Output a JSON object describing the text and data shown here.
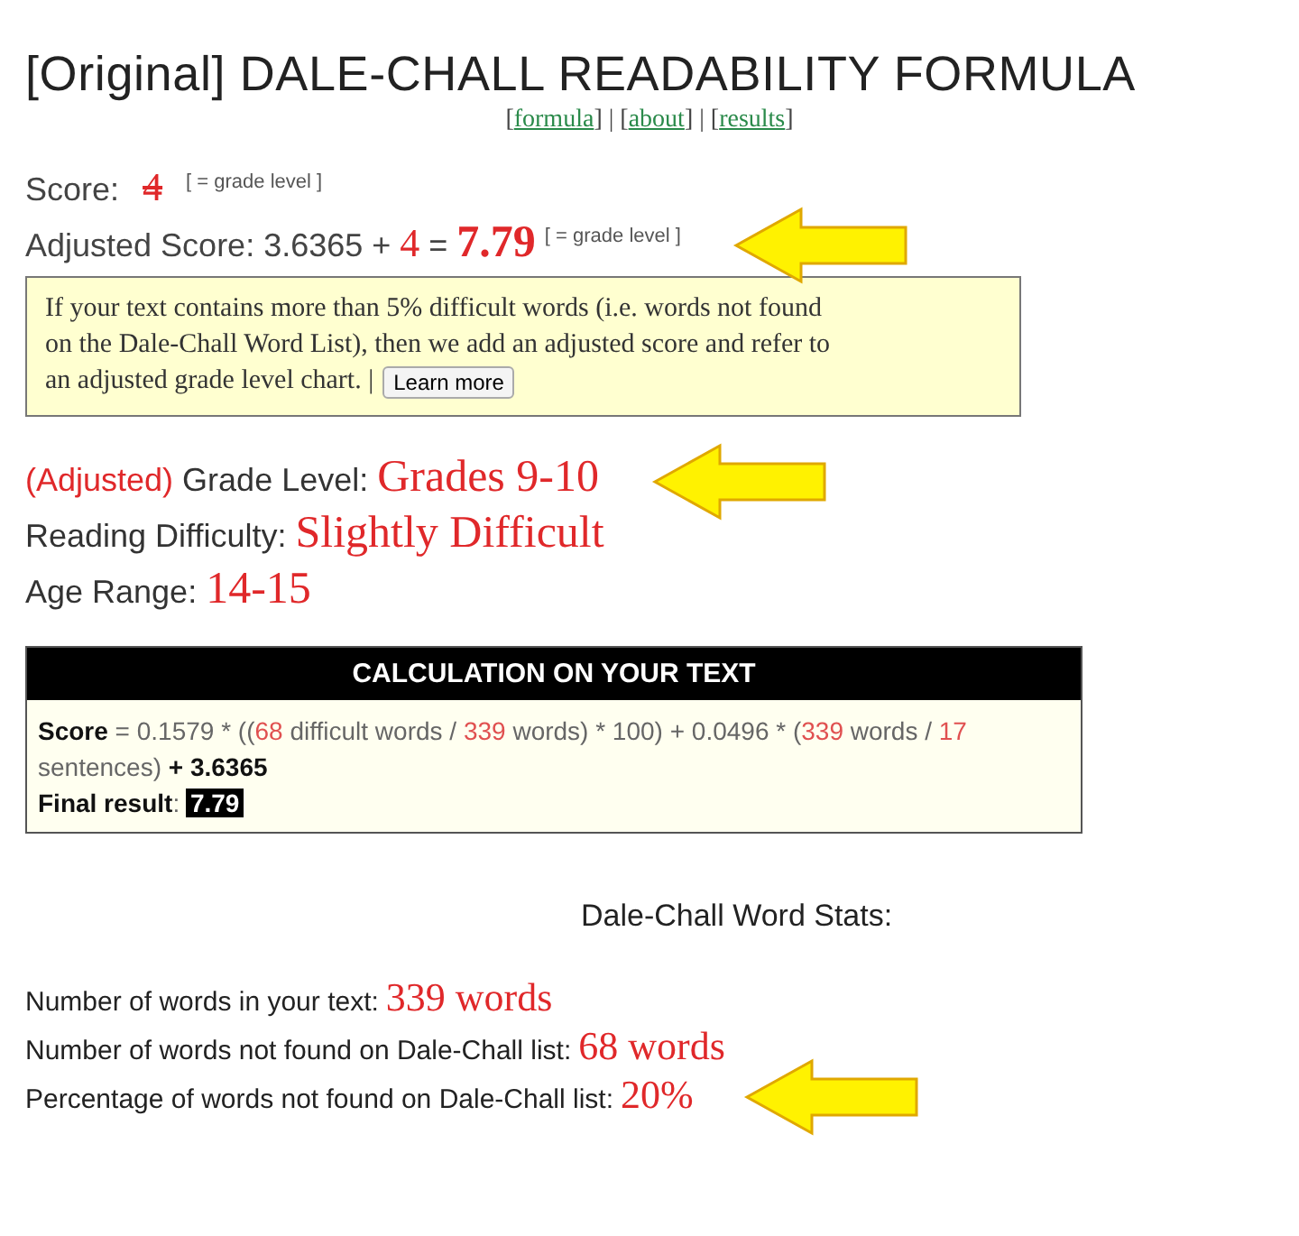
{
  "title": "[Original] DALE-CHALL READABILITY FORMULA",
  "nav": [
    {
      "kind": "punct",
      "text": "["
    },
    {
      "kind": "link",
      "text": "formula"
    },
    {
      "kind": "punct",
      "text": "] | ["
    },
    {
      "kind": "link",
      "text": "about"
    },
    {
      "kind": "punct",
      "text": "] | ["
    },
    {
      "kind": "link",
      "text": "results"
    },
    {
      "kind": "punct",
      "text": "]"
    }
  ],
  "score": {
    "label": "Score:",
    "value": "4",
    "struck": true,
    "note": "[ = grade level ]",
    "arrow": false
  },
  "adjusted_score": {
    "label": "Adjusted Score:",
    "base": "3.6365 +",
    "added": "4",
    "equals": "=",
    "result": "7.79",
    "note": "[ = grade level ]",
    "arrow": true
  },
  "info_box": {
    "lines": [
      "If your text contains more than 5% difficult words (i.e. words not found",
      "on the Dale-Chall Word List), then we add an adjusted score and refer to",
      "an adjusted grade level chart. |"
    ],
    "button": "Learn more"
  },
  "results": [
    {
      "prefix": "(Adjusted)",
      "label": "Grade Level:",
      "value": "Grades 9-10",
      "arrow": true
    },
    {
      "label": "Reading Difficulty:",
      "value": "Slightly Difficult",
      "arrow": false
    },
    {
      "label": "Age Range:",
      "value": "14-15",
      "arrow": false
    }
  ],
  "calculation": {
    "header": "CALCULATION ON YOUR TEXT",
    "formula": [
      {
        "kind": "bold",
        "text": "Score"
      },
      {
        "kind": "plain",
        "text": " = 0.1579 * (("
      },
      {
        "kind": "number",
        "text": "68"
      },
      {
        "kind": "plain",
        "text": " difficult words / "
      },
      {
        "kind": "number",
        "text": "339"
      },
      {
        "kind": "plain",
        "text": " words) * 100) + 0.0496 * ("
      },
      {
        "kind": "number",
        "text": "339"
      },
      {
        "kind": "plain",
        "text": " words / "
      },
      {
        "kind": "number",
        "text": "17"
      },
      {
        "kind": "plain",
        "text": " sentences) "
      },
      {
        "kind": "bold",
        "text": "+ 3.6365"
      }
    ],
    "final_label": "Final result",
    "final_sep": ":",
    "final_value": "7.79"
  },
  "stats": {
    "heading": "Dale-Chall Word Stats:",
    "rows": [
      {
        "label": "Number of words in your text:",
        "value": "339 words",
        "arrow": false
      },
      {
        "label": "Number of words not found on Dale-Chall list:",
        "value": "68 words",
        "arrow": false
      },
      {
        "label": "Percentage of words not found on Dale-Chall list:",
        "value": "20%",
        "arrow": true
      }
    ]
  }
}
